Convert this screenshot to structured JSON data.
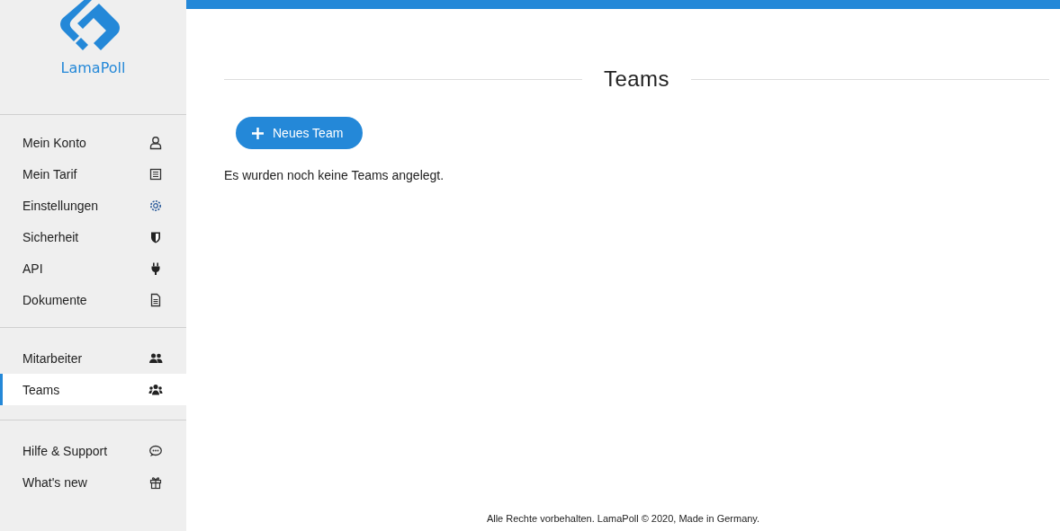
{
  "sidebar": {
    "logo_text": "LamaPoll",
    "groups": [
      {
        "items": [
          {
            "label": "Mein Konto",
            "kind": "user",
            "selected": false
          },
          {
            "label": "Mein Tarif",
            "kind": "receipt",
            "selected": false
          },
          {
            "label": "Einstellungen",
            "kind": "gear",
            "selected": false
          },
          {
            "label": "Sicherheit",
            "kind": "shield",
            "selected": false
          },
          {
            "label": "API",
            "kind": "plug",
            "selected": false
          },
          {
            "label": "Dokumente",
            "kind": "document",
            "selected": false
          }
        ]
      },
      {
        "items": [
          {
            "label": "Mitarbeiter",
            "kind": "users",
            "selected": false
          },
          {
            "label": "Teams",
            "kind": "group",
            "selected": true
          }
        ]
      },
      {
        "items": [
          {
            "label": "Hilfe & Support",
            "kind": "chat",
            "selected": false
          },
          {
            "label": "What's new",
            "kind": "gift",
            "selected": false
          }
        ]
      }
    ]
  },
  "main": {
    "title": "Teams",
    "new_button": "Neues Team",
    "empty_message": "Es wurden noch keine Teams angelegt."
  },
  "footer": "Alle Rechte vorbehalten. LamaPoll © 2020, Made in Germany."
}
